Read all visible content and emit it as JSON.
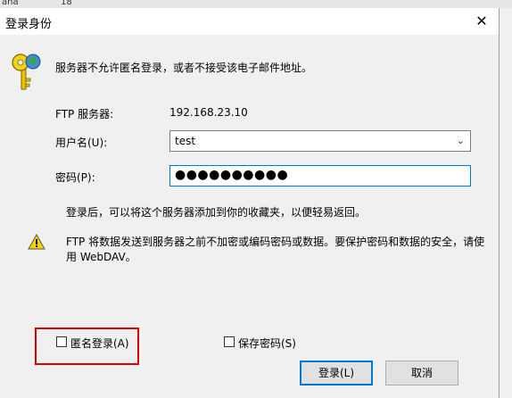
{
  "background": {
    "font_size": "18",
    "app_fragment": "ana"
  },
  "dialog": {
    "title": "登录身份",
    "close_glyph": "✕",
    "message": "服务器不允许匿名登录，或者不接受该电子邮件地址。",
    "ftp_server_label": "FTP 服务器:",
    "ftp_server_value": "192.168.23.10",
    "username_label": "用户名(U):",
    "username_value": "test",
    "password_label": "密码(P):",
    "password_mask": "●●●●●●●●●●",
    "info_text": "登录后，可以将这个服务器添加到你的收藏夹，以便轻易返回。",
    "warning_line1": "FTP 将数据发送到服务器之前不加密或编码密码或数据。要保护密码和数据的安全，请使",
    "warning_line2": "用 WebDAV。",
    "anonymous_label": "匿名登录(A)",
    "save_password_label": "保存密码(S)",
    "login_button": "登录(L)",
    "cancel_button": "取消"
  },
  "colors": {
    "focus_border": "#0078d7",
    "highlight_box": "#e00000"
  }
}
